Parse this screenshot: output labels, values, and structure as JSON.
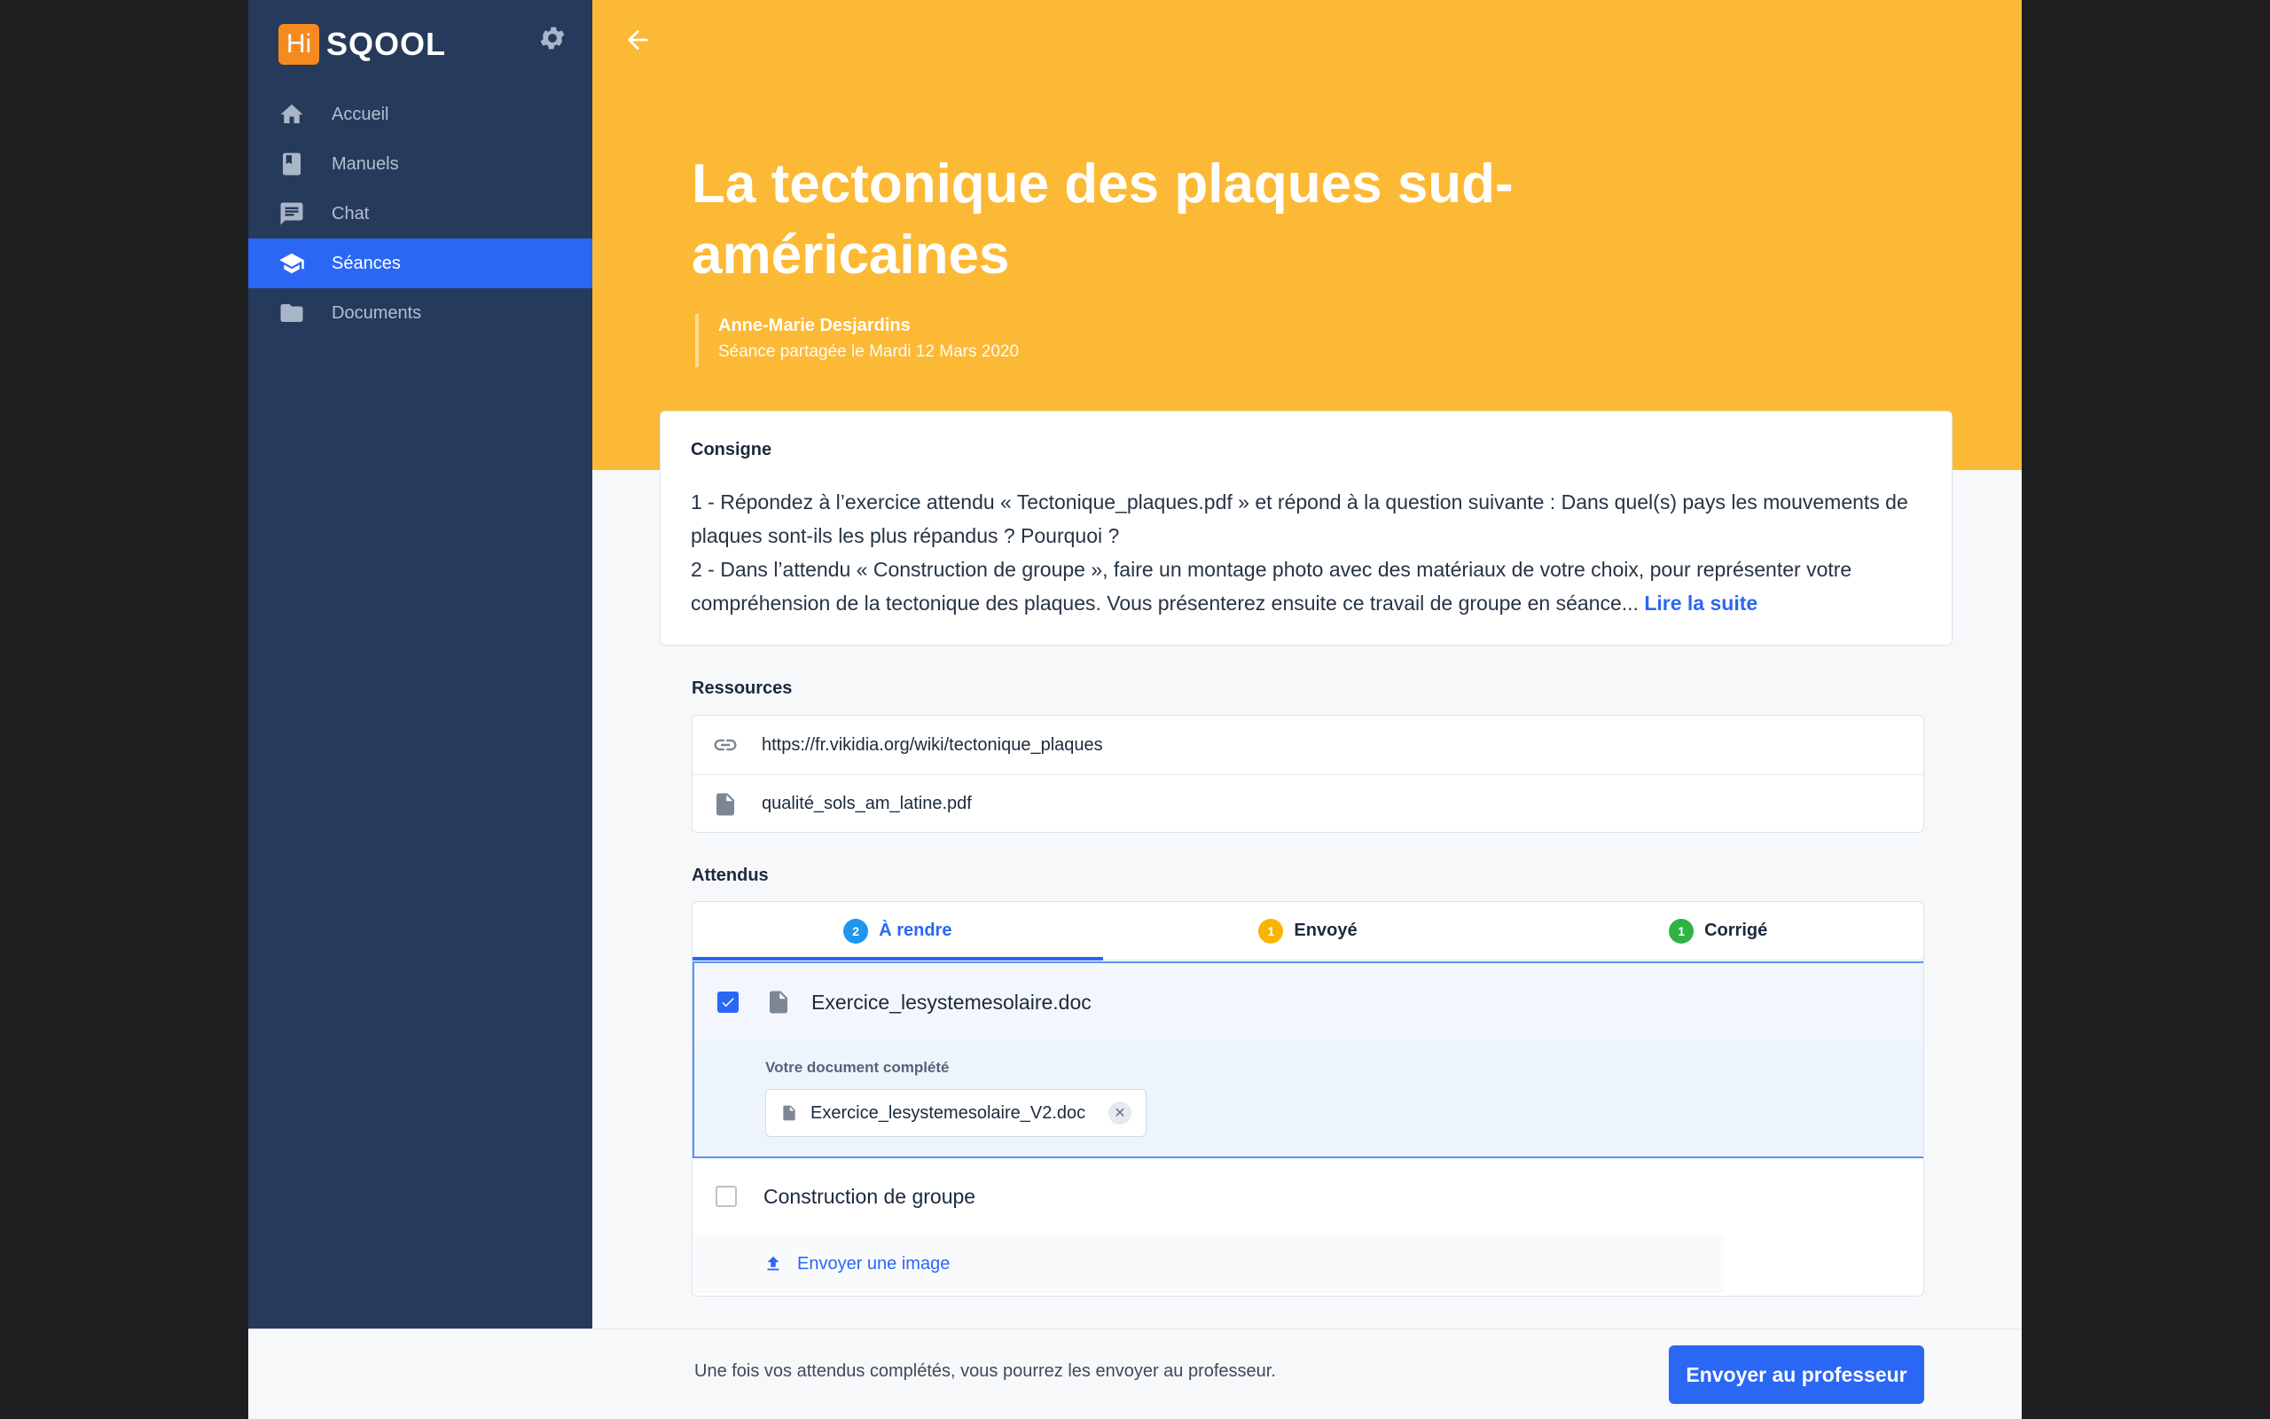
{
  "brand": {
    "hi": "Hi",
    "name": "SQOOL"
  },
  "sidebar": {
    "items": [
      {
        "label": "Accueil",
        "icon": "home-icon"
      },
      {
        "label": "Manuels",
        "icon": "book-icon"
      },
      {
        "label": "Chat",
        "icon": "chat-icon"
      },
      {
        "label": "Séances",
        "icon": "graduation-cap-icon"
      },
      {
        "label": "Documents",
        "icon": "folder-icon"
      }
    ]
  },
  "header": {
    "title": "La tectonique des plaques sud-américaines",
    "author": "Anne-Marie Desjardins",
    "shared_date": "Séance partagée le Mardi 12 Mars 2020"
  },
  "consigne": {
    "label": "Consigne",
    "line1": "1 - Répondez à l’exercice attendu « Tectonique_plaques.pdf » et répond à la question suivante : Dans quel(s) pays les mouvements de plaques sont-ils les plus répandus ? Pourquoi ?",
    "line2": "2 - Dans l’attendu « Construction de groupe », faire un montage photo avec des matériaux de votre choix, pour représenter votre compréhension de la tectonique des plaques. Vous présenterez ensuite ce travail de groupe en séance...",
    "read_more": "Lire la suite"
  },
  "ressources": {
    "label": "Ressources",
    "items": [
      {
        "label": "https://fr.vikidia.org/wiki/tectonique_plaques",
        "icon": "link-icon"
      },
      {
        "label": "qualité_sols_am_latine.pdf",
        "icon": "file-icon"
      }
    ]
  },
  "attendus": {
    "label": "Attendus",
    "tabs": [
      {
        "label": "À rendre",
        "count": "2"
      },
      {
        "label": "Envoyé",
        "count": "1"
      },
      {
        "label": "Corrigé",
        "count": "1"
      }
    ],
    "items": [
      {
        "name": "Exercice_lesystemesolaire.doc",
        "sub_label": "Votre document complété",
        "attachment": "Exercice_lesystemesolaire_V2.doc"
      },
      {
        "name": "Construction de groupe",
        "upload_label": "Envoyer une image"
      }
    ]
  },
  "footer": {
    "info": "Une fois vos attendus complétés, vous pourrez les envoyer au professeur.",
    "button": "Envoyer au professeur"
  },
  "colors": {
    "accent": "#2b67f5",
    "hero": "#fcb935",
    "sidebar": "#263a5c",
    "badge_blue": "#1e96f0",
    "badge_yellow": "#f7b500",
    "badge_green": "#2fb344"
  }
}
